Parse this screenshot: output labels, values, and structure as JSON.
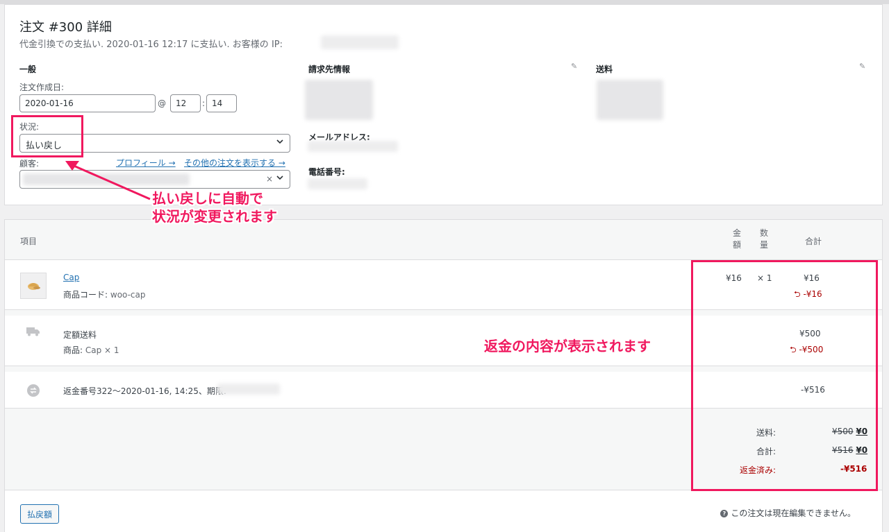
{
  "order": {
    "title": "注文 #300 詳細",
    "meta": "代金引換での支払い. 2020-01-16 12:17 に支払い. お客様の IP:"
  },
  "general": {
    "heading": "一般",
    "date_label": "注文作成日:",
    "date_value": "2020-01-16",
    "at": "@",
    "hour": "12",
    "colon": ":",
    "minute": "14",
    "status_label": "状況:",
    "status_value": "払い戻し",
    "customer_label": "顧客:",
    "profile_link": "プロフィール →",
    "other_orders_link": "その他の注文を表示する →"
  },
  "billing": {
    "heading": "請求先情報",
    "email_label": "メールアドレス:",
    "phone_label": "電話番号:"
  },
  "shipping": {
    "heading": "送料"
  },
  "annotations": {
    "status_callout_1": "払い戻しに自動で",
    "status_callout_2": "状況が変更されます",
    "refund_callout": "返金の内容が表示されます",
    "accent_color": "#f0185e"
  },
  "items": {
    "header": {
      "item": "項目",
      "cost": "金額",
      "qty": "数量",
      "total": "合計"
    },
    "product": {
      "name": "Cap",
      "sku_label": "商品コード:",
      "sku": "woo-cap",
      "cost": "¥16",
      "qty": "× 1",
      "total": "¥16",
      "refunded": "-¥16"
    },
    "shipping_line": {
      "name": "定額送料",
      "items_label": "商品:",
      "items": "Cap × 1",
      "total": "¥500",
      "refunded": "-¥500"
    },
    "refund_line": {
      "text": "返金番号322～2020-01-16, 14:25、期限:",
      "total": "-¥516"
    }
  },
  "totals": {
    "shipping_label": "送料:",
    "shipping_old": "¥500",
    "shipping_new": "¥0",
    "total_label": "合計:",
    "total_old": "¥516",
    "total_new": "¥0",
    "refunded_label": "返金済み:",
    "refunded_value": "-¥516"
  },
  "footer": {
    "refund_button": "払戻額",
    "help_text": "この注文は現在編集できません。",
    "help_icon_glyph": "?"
  }
}
